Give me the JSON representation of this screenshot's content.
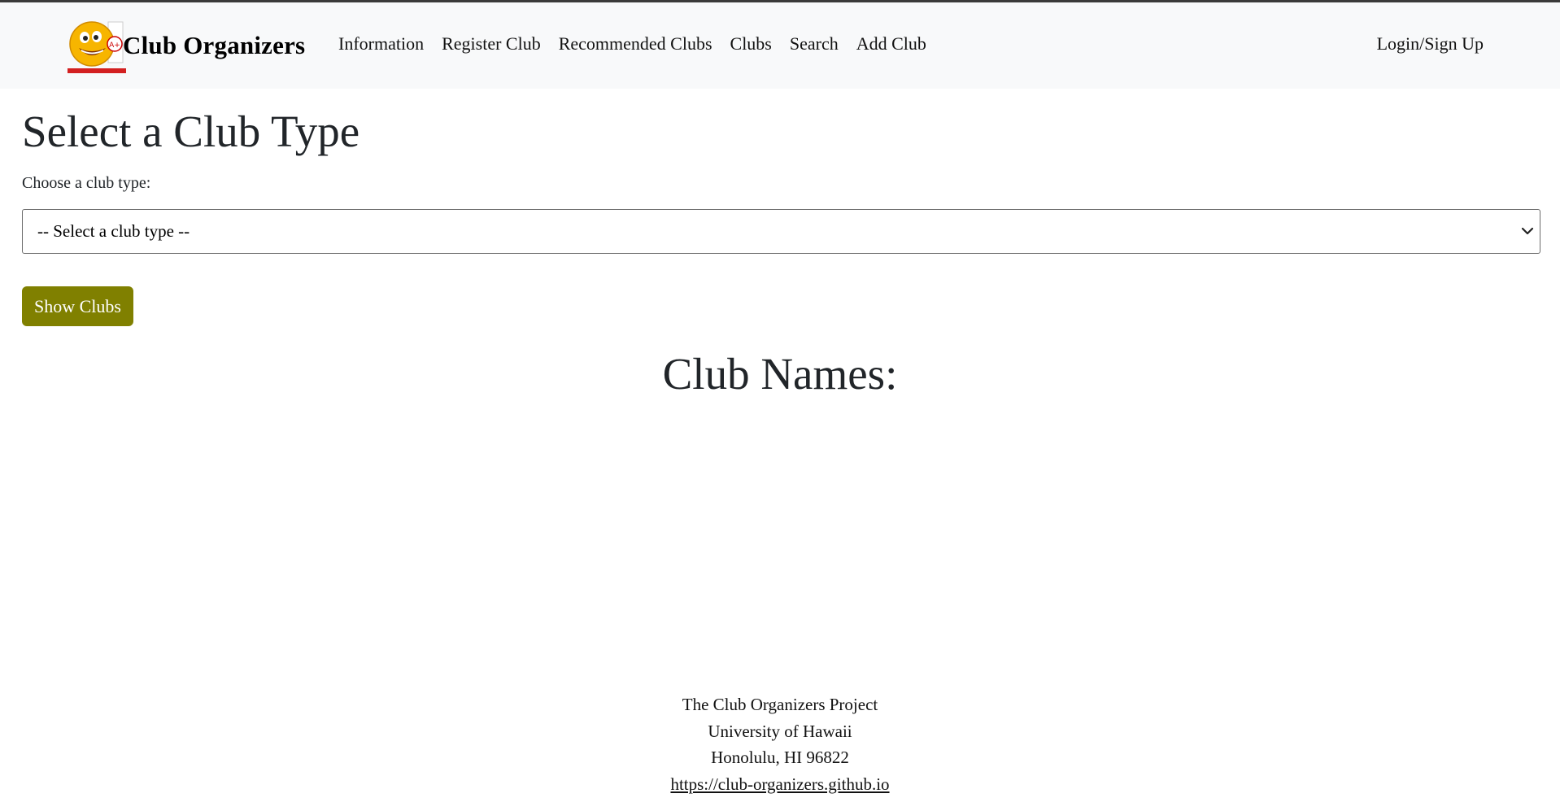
{
  "navbar": {
    "brand_title": "Club Organizers",
    "logo_icon": "smiley-face-logo-icon",
    "links": [
      {
        "label": "Information"
      },
      {
        "label": "Register Club"
      },
      {
        "label": "Recommended Clubs"
      },
      {
        "label": "Clubs"
      },
      {
        "label": "Search"
      },
      {
        "label": "Add Club"
      }
    ],
    "login_label": "Login/Sign Up",
    "background_color": "#f8f9fa"
  },
  "main": {
    "title": "Select a Club Type",
    "select_label": "Choose a club type:",
    "select_value": "-- Select a club type --",
    "show_button_label": "Show Clubs",
    "show_button_color": "#808000",
    "club_names_heading": "Club Names:"
  },
  "footer": {
    "line1": "The Club Organizers Project",
    "line2": "University of Hawaii",
    "line3": "Honolulu, HI 96822",
    "link": "https://club-organizers.github.io"
  }
}
